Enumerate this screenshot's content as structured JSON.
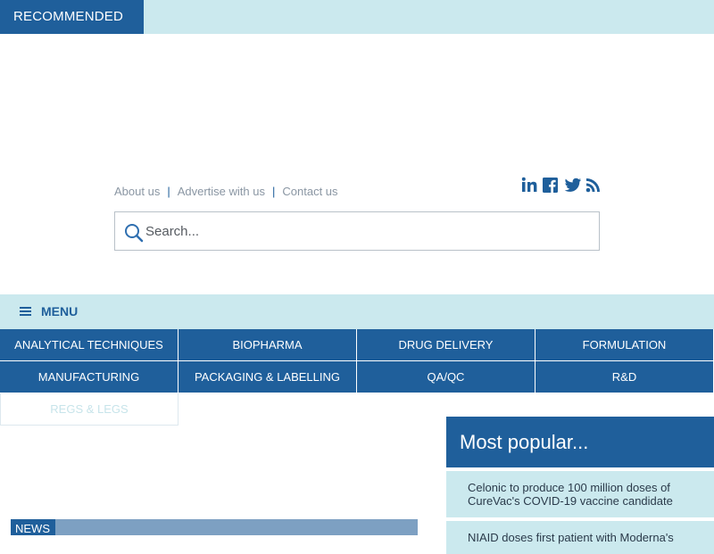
{
  "top": {
    "recommended_label": "RECOMMENDED"
  },
  "util_links": {
    "about": "About us",
    "advertise": "Advertise with us",
    "contact": "Contact us",
    "separator": "|"
  },
  "social": [
    "linkedin-icon",
    "facebook-icon",
    "twitter-icon",
    "rss-icon"
  ],
  "search": {
    "placeholder": "Search..."
  },
  "menu": {
    "label": "MENU"
  },
  "nav": {
    "row1": [
      "ANALYTICAL TECHNIQUES",
      "BIOPHARMA",
      "DRUG DELIVERY",
      "FORMULATION"
    ],
    "row2": [
      "MANUFACTURING",
      "PACKAGING & LABELLING",
      "QA/QC",
      "R&D"
    ],
    "row3": [
      "REGS & LEGS"
    ]
  },
  "sidebar": {
    "title": "Most popular...",
    "items": [
      "Celonic to produce 100 million doses of CureVac's COVID-19 vaccine candidate",
      "NIAID doses first patient with Moderna's"
    ]
  },
  "news": {
    "label": "NEWS"
  },
  "colors": {
    "brand_blue": "#1f5f9b",
    "light_teal": "#cbe9ee"
  }
}
